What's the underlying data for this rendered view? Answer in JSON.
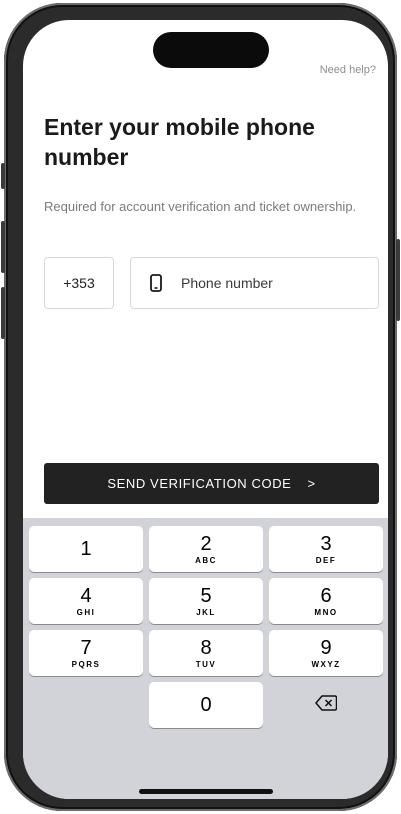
{
  "header": {
    "help_label": "Need help?"
  },
  "main": {
    "title": "Enter your mobile phone number",
    "subtitle": "Required for account verification and ticket ownership.",
    "country_code": "+353",
    "phone_placeholder": "Phone number",
    "phone_icon": "mobile-phone-icon",
    "send_button_label": "SEND VERIFICATION CODE",
    "send_button_chevron": ">"
  },
  "keypad": {
    "keys": [
      {
        "digit": "1",
        "letters": ""
      },
      {
        "digit": "2",
        "letters": "ABC"
      },
      {
        "digit": "3",
        "letters": "DEF"
      },
      {
        "digit": "4",
        "letters": "GHI"
      },
      {
        "digit": "5",
        "letters": "JKL"
      },
      {
        "digit": "6",
        "letters": "MNO"
      },
      {
        "digit": "7",
        "letters": "PQRS"
      },
      {
        "digit": "8",
        "letters": "TUV"
      },
      {
        "digit": "9",
        "letters": "WXYZ"
      },
      {
        "digit": "0",
        "letters": ""
      }
    ],
    "delete_icon": "backspace-icon"
  },
  "colors": {
    "button_background": "#222222",
    "keyboard_background": "#d1d3d9",
    "muted_text": "#7b7b7b"
  }
}
